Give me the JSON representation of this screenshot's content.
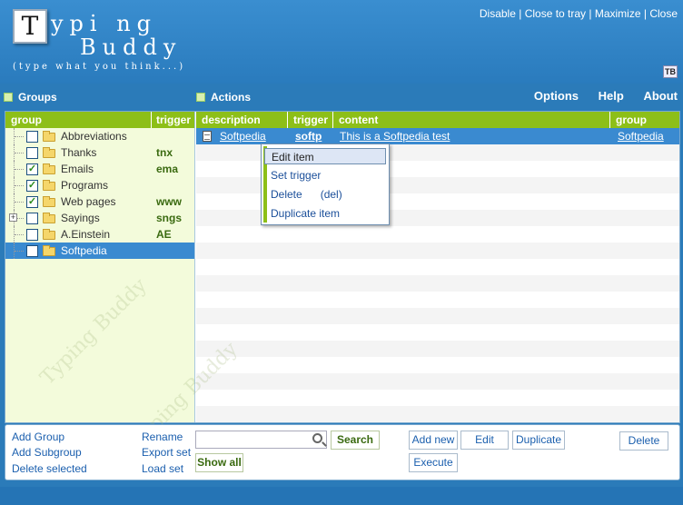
{
  "app": {
    "logo_letter": "T",
    "logo_line1": "ypi ng",
    "logo_line2": "Buddy",
    "tagline": "(type what you think...)",
    "badge": "TB"
  },
  "window_controls": [
    "Disable",
    "Close to tray",
    "Maximize",
    "Close"
  ],
  "groups_title": "Groups",
  "actions_title": "Actions",
  "menu": [
    "Options",
    "Help",
    "About"
  ],
  "groups_table": {
    "headers": [
      "group",
      "trigger"
    ],
    "rows": [
      {
        "name": "Abbreviations",
        "trigger": "",
        "checked": false,
        "expandable": false,
        "selected": false
      },
      {
        "name": "Thanks",
        "trigger": "tnx",
        "checked": false,
        "expandable": false,
        "selected": false
      },
      {
        "name": "Emails",
        "trigger": "ema",
        "checked": true,
        "expandable": false,
        "selected": false
      },
      {
        "name": "Programs",
        "trigger": "",
        "checked": true,
        "expandable": false,
        "selected": false
      },
      {
        "name": "Web pages",
        "trigger": "www",
        "checked": true,
        "expandable": false,
        "selected": false
      },
      {
        "name": "Sayings",
        "trigger": "sngs",
        "checked": false,
        "expandable": true,
        "selected": false
      },
      {
        "name": "A.Einstein",
        "trigger": "AE",
        "checked": false,
        "expandable": false,
        "selected": false
      },
      {
        "name": "Softpedia",
        "trigger": "",
        "checked": false,
        "expandable": false,
        "selected": true
      }
    ]
  },
  "items_table": {
    "headers": [
      "description",
      "trigger",
      "content",
      "group"
    ],
    "rows": [
      {
        "description": "Softpedia",
        "trigger": "softp",
        "content": "This is a Softpedia test",
        "group": "Softpedia"
      }
    ]
  },
  "context_menu": [
    "Edit item",
    "Set trigger",
    "Delete      (del)",
    "Duplicate item"
  ],
  "bottom": {
    "group_links": [
      "Add Group",
      "Add Subgroup",
      "Delete selected"
    ],
    "set_links": [
      "Rename",
      "Export set",
      "Load set"
    ],
    "search_value": "",
    "search_button": "Search",
    "show_all_button": "Show all",
    "add_new_button": "Add new",
    "edit_button": "Edit",
    "duplicate_button": "Duplicate",
    "execute_button": "Execute",
    "delete_button": "Delete"
  },
  "icons": {
    "folder": "folder-icon",
    "document": "document-icon",
    "search": "magnifier-icon"
  },
  "colors": {
    "window_blue": "#2b7bb9",
    "header_green": "#8dbf18",
    "selection_blue": "#3a8ad0",
    "link_blue": "#1b4f9a"
  }
}
